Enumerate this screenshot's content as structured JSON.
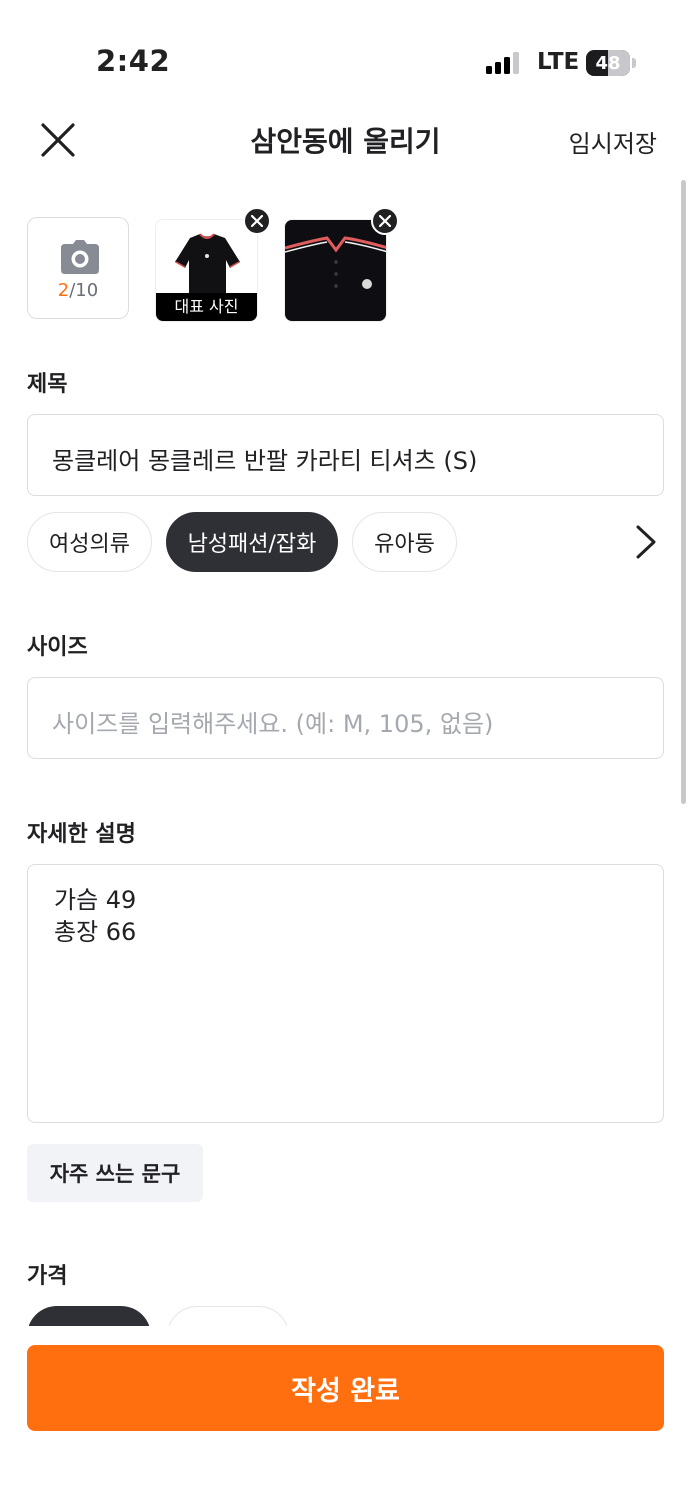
{
  "status_bar": {
    "time": "2:42",
    "network": "LTE",
    "battery": "48"
  },
  "nav": {
    "title": "삼안동에 올리기",
    "draft_label": "임시저장"
  },
  "photos": {
    "count_current": "2",
    "count_max": "/10",
    "representative_label": "대표 사진"
  },
  "title_section": {
    "label": "제목",
    "value": "몽클레어 몽클레르 반팔 카라티 티셔츠 (S)"
  },
  "categories": [
    {
      "label": "여성의류",
      "active": false
    },
    {
      "label": "남성패션/잡화",
      "active": true
    },
    {
      "label": "유아동",
      "active": false
    }
  ],
  "size_section": {
    "label": "사이즈",
    "placeholder": "사이즈를 입력해주세요. (예: M, 105, 없음)"
  },
  "description_section": {
    "label": "자세한 설명",
    "lines": [
      "가슴 49",
      "총장 66"
    ],
    "frequent_phrase_label": "자주 쓰는 문구"
  },
  "price_section": {
    "label": "가격"
  },
  "submit_label": "작성 완료",
  "colors": {
    "accent": "#ff6f0f",
    "chip_active": "#2f3035",
    "border": "#dcdde0"
  }
}
